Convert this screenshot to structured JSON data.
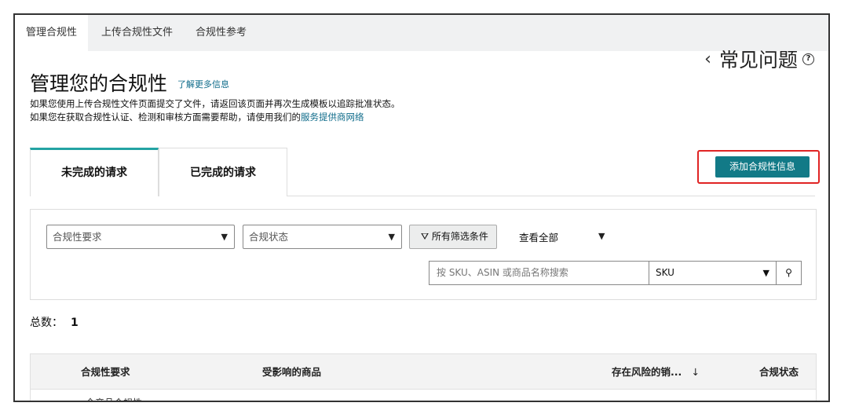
{
  "top_tabs": [
    {
      "label": "管理合规性"
    },
    {
      "label": "上传合规性文件"
    },
    {
      "label": "合规性参考"
    }
  ],
  "help": {
    "label": "常见问题"
  },
  "page": {
    "title": "管理您的合规性",
    "learn_more": "了解更多信息",
    "desc1": "如果您使用上传合规性文件页面提交了文件，请返回该页面并再次生成模板以追踪批准状态。",
    "desc2_prefix": "如果您在获取合规性认证、检测和审核方面需要帮助，请使用我们的",
    "desc2_link": "服务提供商网络"
  },
  "request_tabs": [
    {
      "label": "未完成的请求"
    },
    {
      "label": "已完成的请求"
    }
  ],
  "add_button": "添加合规性信息",
  "filters": {
    "requirement_placeholder": "合规性要求",
    "status_placeholder": "合规状态",
    "all_filters": "所有筛选条件",
    "view_all": "查看全部",
    "search_placeholder": "按 SKU、ASIN 或商品名称搜索",
    "search_type": "SKU"
  },
  "total": {
    "label": "总数：",
    "value": "1"
  },
  "table": {
    "headers": [
      "合规性要求",
      "受影响的商品",
      "存在风险的销...",
      "合规状态"
    ],
    "sort_icon": "↓",
    "first_row": "全产品合规性"
  }
}
